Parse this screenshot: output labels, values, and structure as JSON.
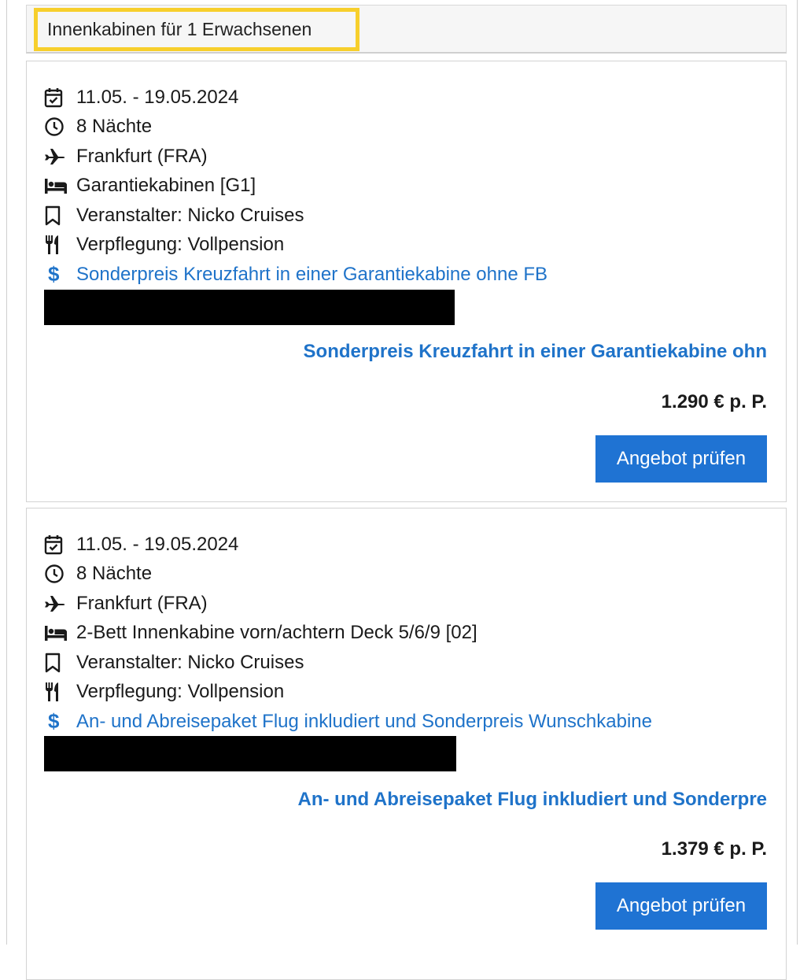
{
  "header": {
    "title": "Innenkabinen für 1 Erwachsenen"
  },
  "offers": [
    {
      "date": "11.05. - 19.05.2024",
      "nights": "8 Nächte",
      "departure": "Frankfurt (FRA)",
      "cabin": "Garantiekabinen [G1]",
      "operator": "Veranstalter: Nicko Cruises",
      "board": "Verpflegung: Vollpension",
      "promo": "Sonderpreis Kreuzfahrt in einer Garantiekabine ohne FB",
      "offer_title": "Sonderpreis Kreuzfahrt in einer Garantiekabine ohn",
      "price": "1.290 € p. P.",
      "cta_label": "Angebot prüfen"
    },
    {
      "date": "11.05. - 19.05.2024",
      "nights": "8 Nächte",
      "departure": "Frankfurt (FRA)",
      "cabin": "2-Bett Innenkabine vorn/achtern Deck 5/6/9 [02]",
      "operator": "Veranstalter: Nicko Cruises",
      "board": "Verpflegung: Vollpension",
      "promo": "An- und Abreisepaket Flug inkludiert und Sonderpreis Wunschkabine",
      "offer_title": "An- und Abreisepaket Flug inkludiert und Sonderpre",
      "price": "1.379 € p. P.",
      "cta_label": "Angebot prüfen"
    }
  ],
  "icons": {
    "date": "calendar-check-icon",
    "nights": "clock-icon",
    "departure": "airplane-icon",
    "cabin": "bed-icon",
    "operator": "bookmark-icon",
    "board": "utensils-icon",
    "promo": "dollar-icon"
  },
  "colors": {
    "link": "#1f73c9",
    "button": "#1f73d3",
    "highlight": "#f7cf2c"
  }
}
